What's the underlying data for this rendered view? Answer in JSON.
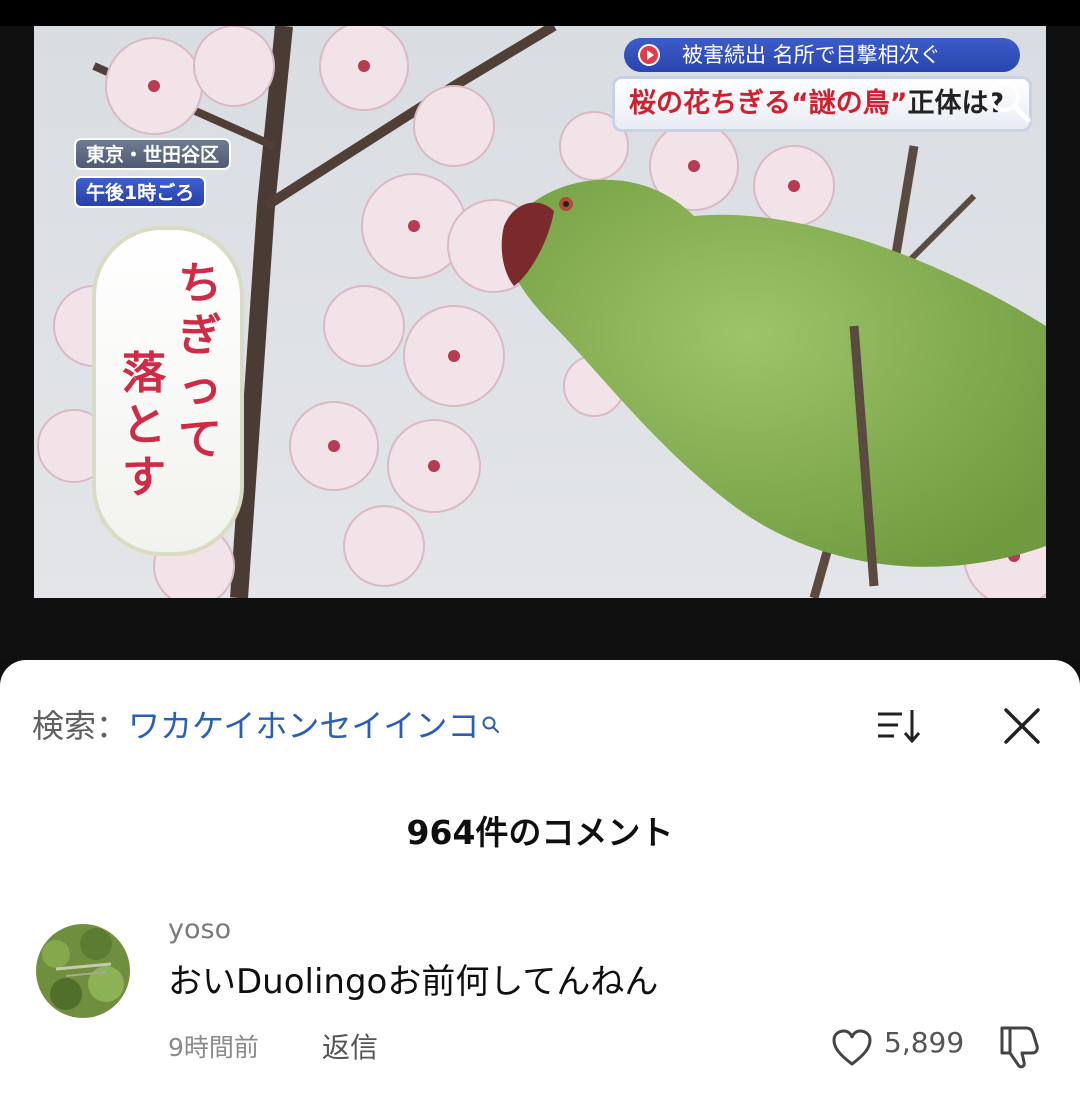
{
  "video": {
    "banner_top": "被害続出 名所で目撃相次ぐ",
    "banner_main_red_1": "桜の花ちぎる",
    "banner_main_red_2": "“謎の鳥”",
    "banner_main_dark": "正体は",
    "banner_main_end": "?",
    "location": "東京・世田谷区",
    "time_of_day": "午後1時ごろ",
    "caption_col_1": "ちぎって",
    "caption_col_2": "落とす"
  },
  "search": {
    "label": "検索：",
    "term": "ワカケイホンセイインコ"
  },
  "comments": {
    "count_title": "964件のコメント",
    "items": [
      {
        "username": "yoso",
        "text": "おいDuolingoお前何してんねん",
        "time": "9時間前",
        "reply_label": "返信",
        "likes": "5,899"
      }
    ]
  },
  "colors": {
    "accent_link": "#2a5fb8",
    "caption_red": "#cf2a46",
    "banner_blue": "#2a46ad"
  },
  "icons": [
    "search-icon",
    "sort-icon",
    "close-icon",
    "heart-icon",
    "dislike-icon"
  ]
}
